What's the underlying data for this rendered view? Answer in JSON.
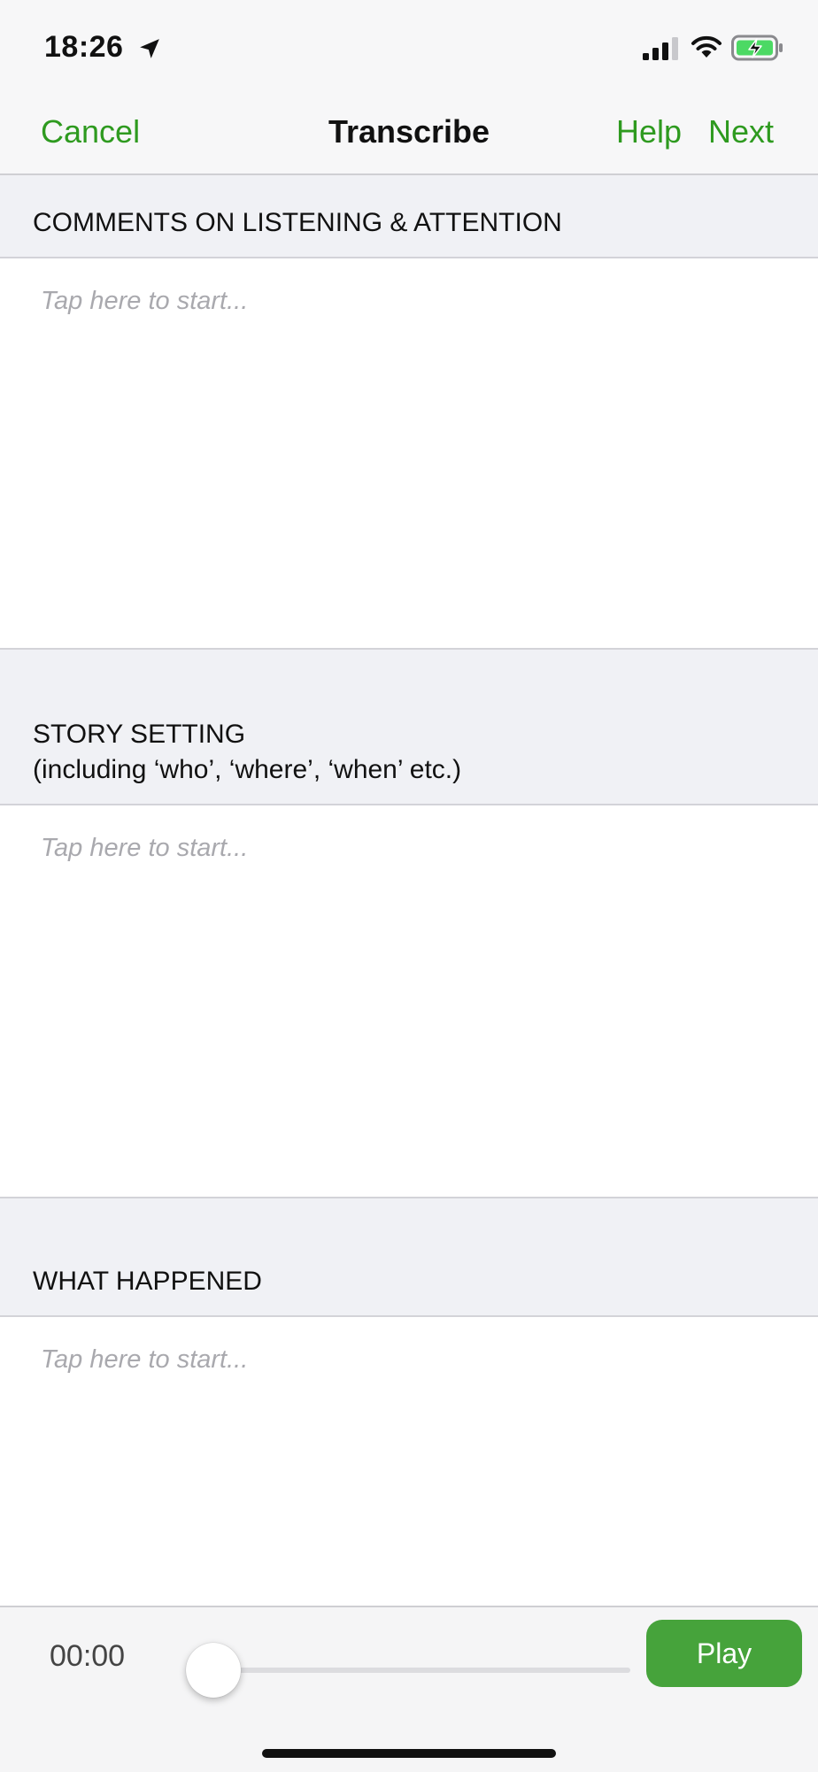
{
  "status_bar": {
    "time": "18:26",
    "icons": [
      "location-arrow-icon",
      "cellular-signal-icon",
      "wifi-icon",
      "battery-charging-icon"
    ]
  },
  "nav": {
    "cancel_label": "Cancel",
    "title": "Transcribe",
    "help_label": "Help",
    "next_label": "Next"
  },
  "sections": [
    {
      "header": "COMMENTS ON LISTENING & ATTENTION",
      "subheader": "",
      "placeholder": "Tap here to start..."
    },
    {
      "header": "STORY SETTING",
      "subheader": "(including ‘who’, ‘where’, ‘when’ etc.)",
      "placeholder": "Tap here to start..."
    },
    {
      "header": "WHAT HAPPENED",
      "subheader": "",
      "placeholder": "Tap here to start..."
    }
  ],
  "player": {
    "time": "00:00",
    "progress": 0,
    "play_label": "Play"
  },
  "colors": {
    "accent": "#2e9a1f",
    "play_button": "#46a33b",
    "section_background": "#f0f1f5",
    "placeholder": "#a9a9ae"
  }
}
